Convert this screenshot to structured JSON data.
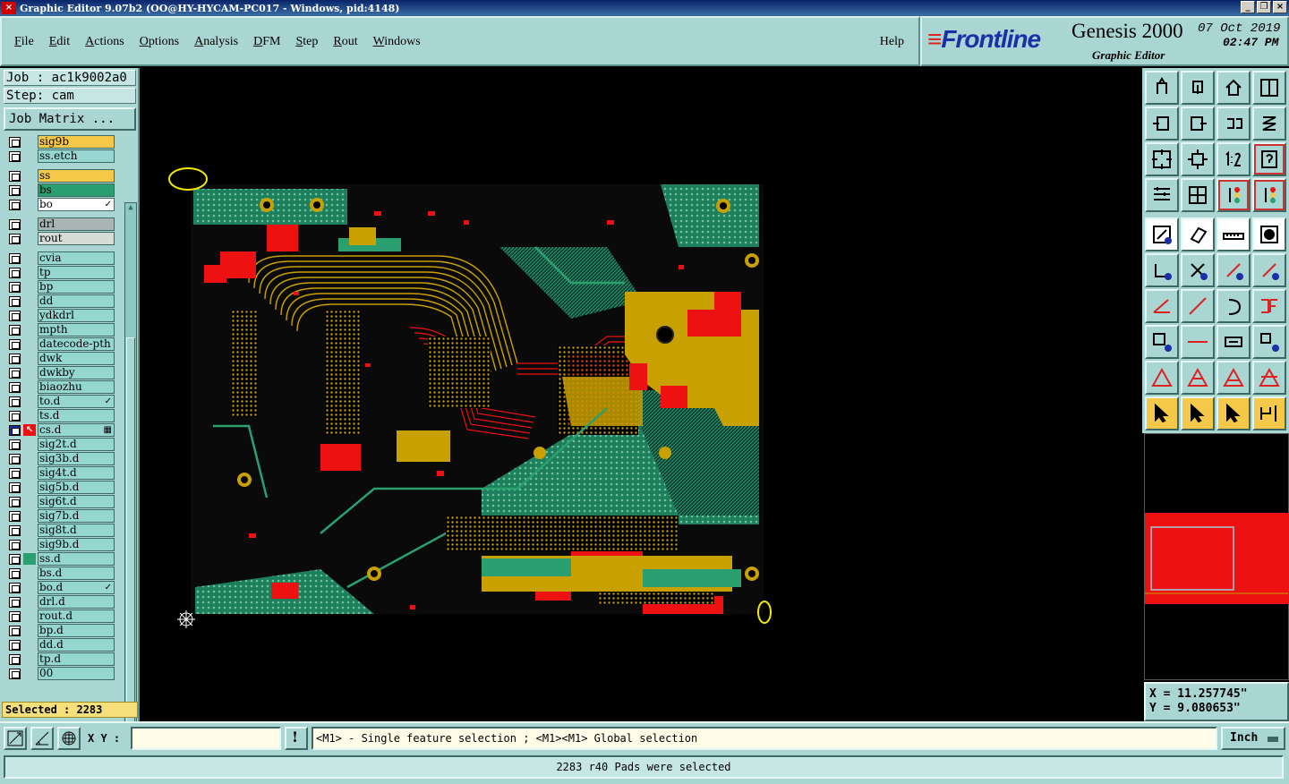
{
  "window": {
    "title": "Graphic Editor 9.07b2  (OO@HY-HYCAM-PC017 - Windows, pid:4148)"
  },
  "menu": {
    "items": [
      "File",
      "Edit",
      "Actions",
      "Options",
      "Analysis",
      "DFM",
      "Step",
      "Rout",
      "Windows"
    ],
    "help": "Help"
  },
  "brand": {
    "logo": "Frontline",
    "product": "Genesis 2000",
    "subtitle": "Graphic Editor",
    "date": "07 Oct 2019",
    "time": "02:47 PM"
  },
  "job": {
    "job_label": "Job : ac1k9002a0",
    "step_label": "Step: cam",
    "matrix_button": "Job Matrix ..."
  },
  "layers": [
    {
      "name": "sig9b",
      "color": "#f5c84a",
      "tag": ""
    },
    {
      "name": "ss.etch",
      "color": "#95d6d0",
      "tag": ""
    },
    {
      "name": "ss",
      "color": "#f5c84a",
      "tag": ""
    },
    {
      "name": "bs",
      "color": "#2aa070",
      "tag": ""
    },
    {
      "name": "bo",
      "color": "#ffffff",
      "tag": "",
      "mark": "✓"
    },
    {
      "name": "drl",
      "color": "#a9b5b3",
      "tag": ""
    },
    {
      "name": "rout",
      "color": "#d8dcd8",
      "tag": ""
    },
    {
      "name": "cvia",
      "color": "#95d6d0",
      "tag": ""
    },
    {
      "name": "tp",
      "color": "#95d6d0",
      "tag": ""
    },
    {
      "name": "bp",
      "color": "#95d6d0",
      "tag": ""
    },
    {
      "name": "dd",
      "color": "#95d6d0",
      "tag": ""
    },
    {
      "name": "ydkdrl",
      "color": "#95d6d0",
      "tag": ""
    },
    {
      "name": "mpth",
      "color": "#95d6d0",
      "tag": ""
    },
    {
      "name": "datecode-pth",
      "color": "#95d6d0",
      "tag": ""
    },
    {
      "name": "dwk",
      "color": "#95d6d0",
      "tag": ""
    },
    {
      "name": "dwkby",
      "color": "#95d6d0",
      "tag": ""
    },
    {
      "name": "biaozhu",
      "color": "#95d6d0",
      "tag": ""
    },
    {
      "name": "to.d",
      "color": "#95d6d0",
      "tag": "",
      "mark": "✓"
    },
    {
      "name": "ts.d",
      "color": "#95d6d0",
      "tag": ""
    },
    {
      "name": "cs.d",
      "color": "#95d6d0",
      "tag": "work",
      "mark": "▦"
    },
    {
      "name": "sig2t.d",
      "color": "#95d6d0",
      "tag": ""
    },
    {
      "name": "sig3b.d",
      "color": "#95d6d0",
      "tag": ""
    },
    {
      "name": "sig4t.d",
      "color": "#95d6d0",
      "tag": ""
    },
    {
      "name": "sig5b.d",
      "color": "#95d6d0",
      "tag": ""
    },
    {
      "name": "sig6t.d",
      "color": "#95d6d0",
      "tag": ""
    },
    {
      "name": "sig7b.d",
      "color": "#95d6d0",
      "tag": ""
    },
    {
      "name": "sig8t.d",
      "color": "#95d6d0",
      "tag": ""
    },
    {
      "name": "sig9b.d",
      "color": "#95d6d0",
      "tag": ""
    },
    {
      "name": "ss.d",
      "color": "#95d6d0",
      "tag": "green"
    },
    {
      "name": "bs.d",
      "color": "#95d6d0",
      "tag": ""
    },
    {
      "name": "bo.d",
      "color": "#95d6d0",
      "tag": "",
      "mark": "✓"
    },
    {
      "name": "drl.d",
      "color": "#95d6d0",
      "tag": ""
    },
    {
      "name": "rout.d",
      "color": "#95d6d0",
      "tag": ""
    },
    {
      "name": "bp.d",
      "color": "#95d6d0",
      "tag": ""
    },
    {
      "name": "dd.d",
      "color": "#95d6d0",
      "tag": ""
    },
    {
      "name": "tp.d",
      "color": "#95d6d0",
      "tag": ""
    },
    {
      "name": "00",
      "color": "#95d6d0",
      "tag": ""
    }
  ],
  "selection": {
    "selected": "Selected : 2283"
  },
  "coords": {
    "x": "X = 11.257745\"",
    "y": "Y = 9.080653\""
  },
  "input": {
    "xy_label": "X Y :",
    "xy_value": "",
    "prompt": "<M1> - Single feature selection ; <M1><M1> Global selection",
    "units": "Inch"
  },
  "status": {
    "message": "2283 r40 Pads were selected"
  },
  "colors": {
    "panel": "#a9d6d2",
    "copper_red": "#ee1111",
    "copper_gold": "#c8a000",
    "copper_green": "#2aa070",
    "canvas": "#000000"
  },
  "icons": {
    "tools": [
      "export-icon",
      "import-icon",
      "home-icon",
      "split-view-icon",
      "left-icon",
      "right-icon",
      "undo-icon",
      "snap-icon",
      "fit-all-icon",
      "fit-profile-icon",
      "one-to-two-icon",
      "help-icon",
      "settings-icon",
      "grid-icon",
      "layer-color-icon",
      "layer-color-2-icon",
      "add-pad-icon",
      "add-surface-icon",
      "measure-icon",
      "add-circle-icon",
      "nodes-icon",
      "delete-feature-icon",
      "move-node-icon",
      "add-line-icon",
      "angle-icon",
      "draw-line-icon",
      "arc-icon",
      "mirror-icon",
      "pad-icon",
      "line-icon",
      "resize-icon",
      "shapes-icon",
      "triangle-a-icon",
      "triangle-b-icon",
      "triangle-c-icon",
      "triangle-d-icon",
      "pointer-icon",
      "pointer-box-icon",
      "pointer-select-icon",
      "route-select-icon"
    ]
  }
}
